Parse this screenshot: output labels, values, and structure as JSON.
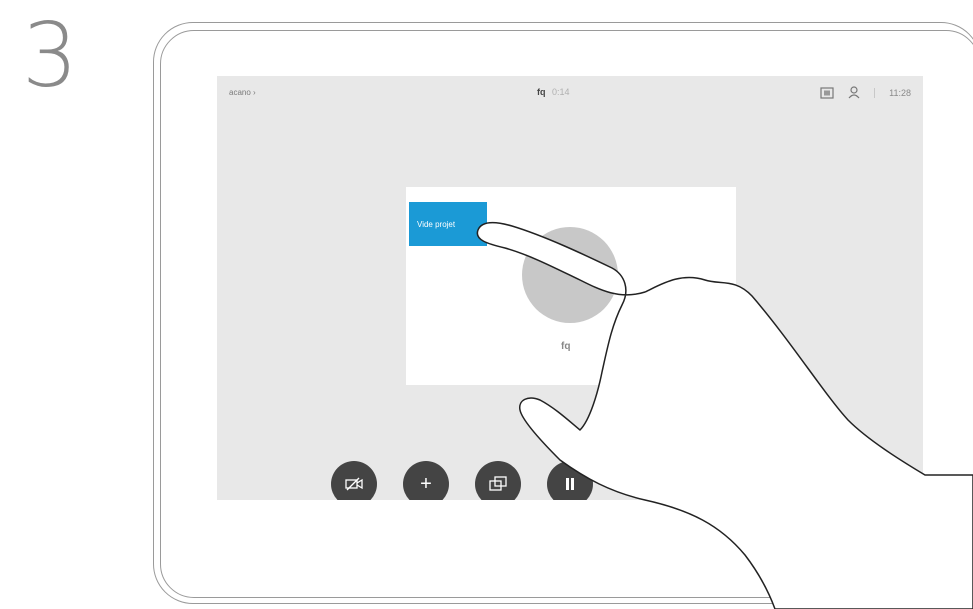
{
  "step": {
    "number": "3"
  },
  "status_bar": {
    "left_text": "acano ›",
    "center_name": "fq",
    "center_time": "0:14",
    "layout_icon": "layout-icon",
    "person_icon": "person-icon",
    "clock": "11:28"
  },
  "call": {
    "overlay_button_label": "Vide projet",
    "participant_initials": "fq"
  },
  "controls": {
    "video_icon": "camera-off-icon",
    "add_symbol": "+",
    "share_icon": "share-icon",
    "hold_icon": "hold-icon"
  },
  "device_buttons": {
    "volume_icon": "speaker-icon",
    "mute_icon": "microphone-muted-icon"
  },
  "colors": {
    "accent": "#1b9ad6",
    "control_bg": "#444444",
    "screen_bg": "#e8e8e8"
  }
}
